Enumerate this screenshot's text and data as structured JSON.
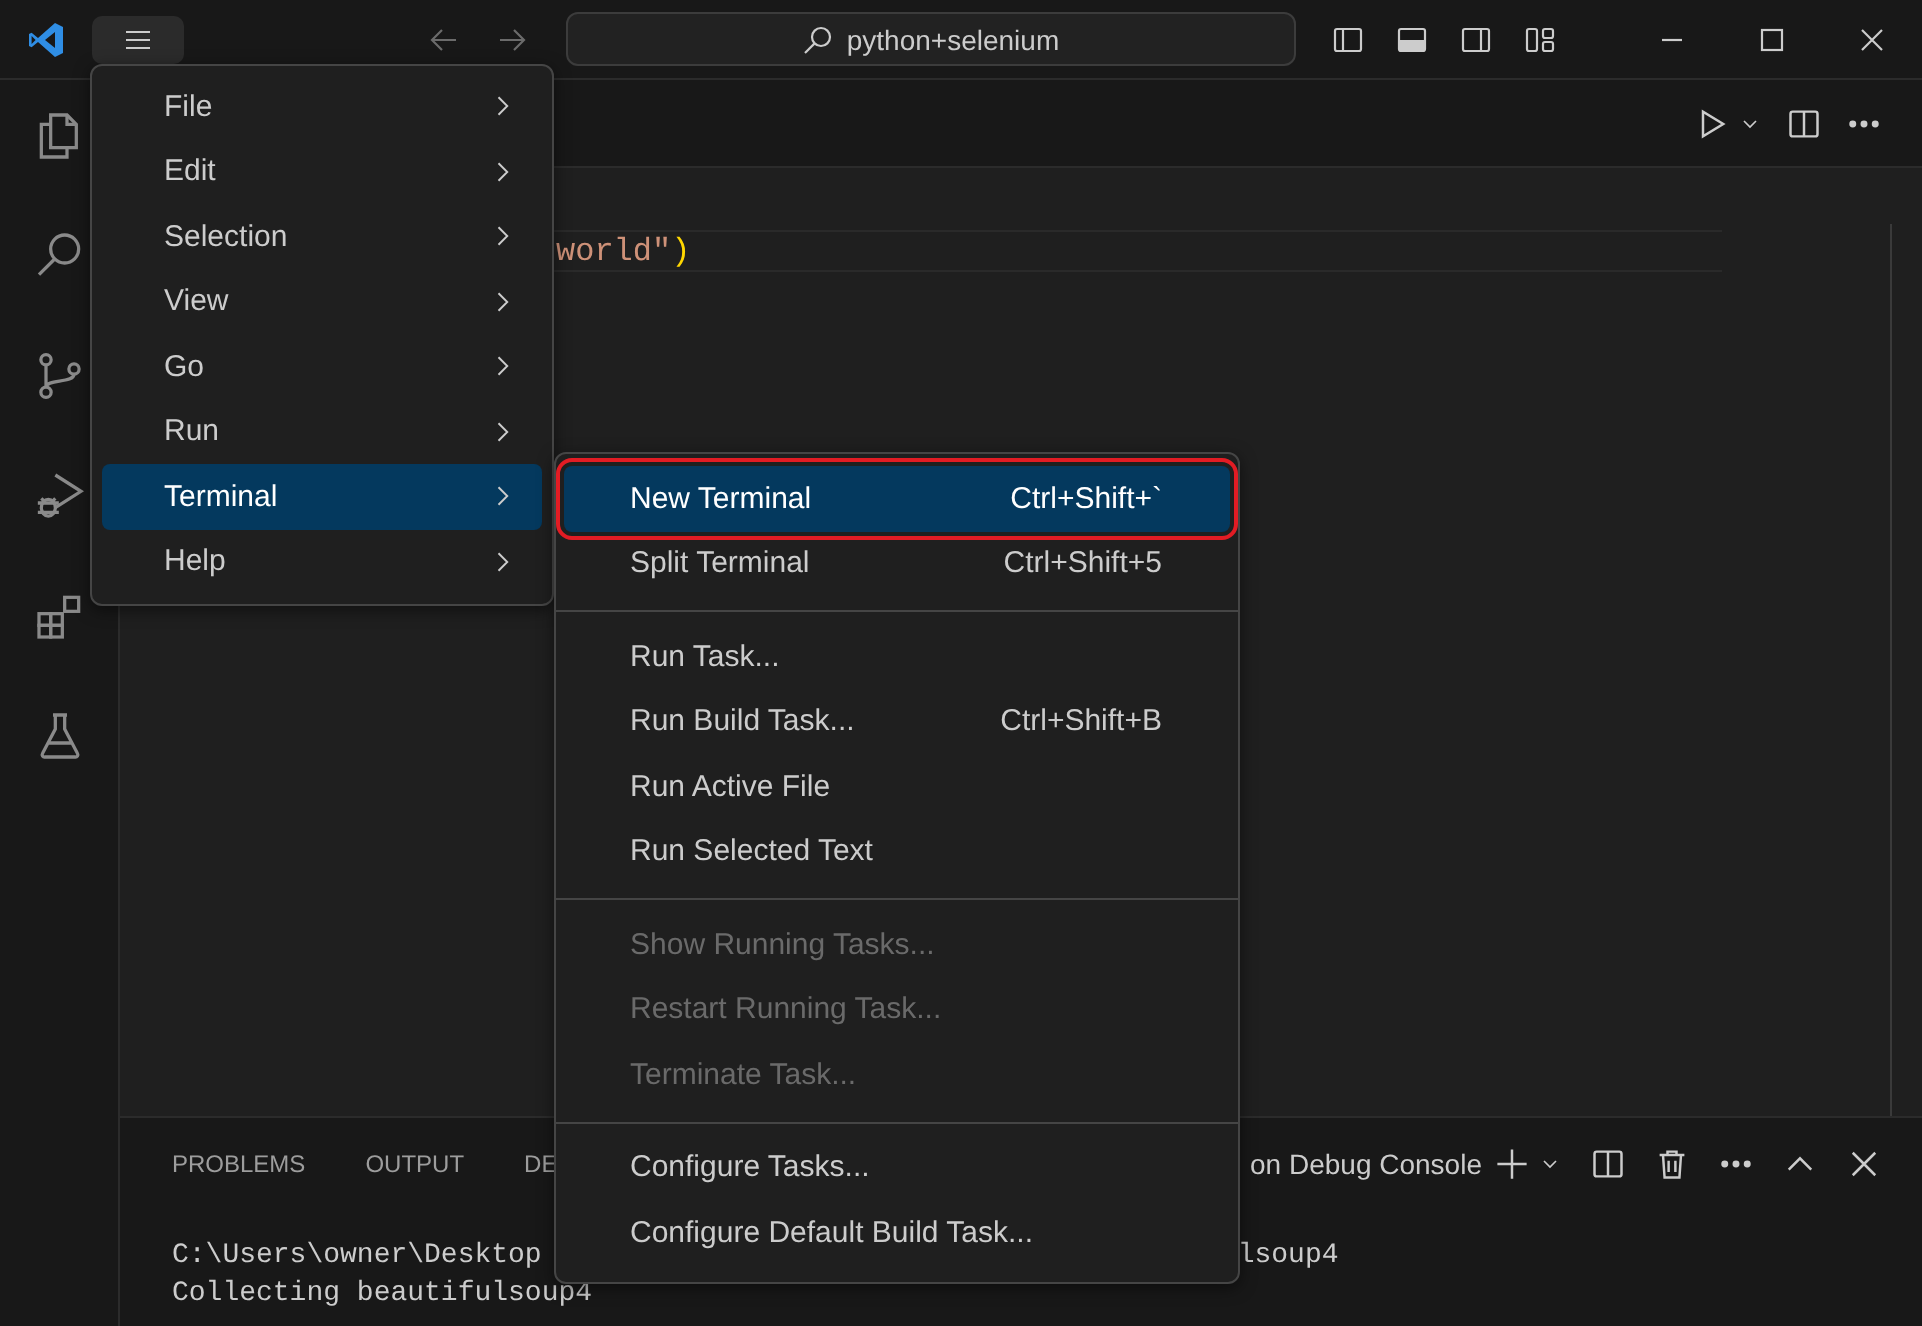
{
  "title_bar": {
    "search": "python+selenium"
  },
  "editor": {
    "code_tokens": [
      {
        "text": "world\"",
        "kind": "string"
      },
      {
        "text": ")",
        "kind": "bracket"
      }
    ]
  },
  "menu": {
    "items": [
      {
        "label": "File",
        "selected": false
      },
      {
        "label": "Edit",
        "selected": false
      },
      {
        "label": "Selection",
        "selected": false
      },
      {
        "label": "View",
        "selected": false
      },
      {
        "label": "Go",
        "selected": false
      },
      {
        "label": "Run",
        "selected": false
      },
      {
        "label": "Terminal",
        "selected": true
      },
      {
        "label": "Help",
        "selected": false
      }
    ]
  },
  "submenu": {
    "items": [
      {
        "kind": "item",
        "label": "New Terminal",
        "shortcut": "Ctrl+Shift+`",
        "selected": true,
        "disabled": false,
        "annotated": true
      },
      {
        "kind": "item",
        "label": "Split Terminal",
        "shortcut": "Ctrl+Shift+5",
        "selected": false,
        "disabled": false,
        "annotated": false
      },
      {
        "kind": "separator"
      },
      {
        "kind": "item",
        "label": "Run Task...",
        "selected": false,
        "disabled": false,
        "annotated": false
      },
      {
        "kind": "item",
        "label": "Run Build Task...",
        "shortcut": "Ctrl+Shift+B",
        "selected": false,
        "disabled": false,
        "annotated": false
      },
      {
        "kind": "item",
        "label": "Run Active File",
        "selected": false,
        "disabled": false,
        "annotated": false
      },
      {
        "kind": "item",
        "label": "Run Selected Text",
        "selected": false,
        "disabled": false,
        "annotated": false
      },
      {
        "kind": "separator"
      },
      {
        "kind": "item",
        "label": "Show Running Tasks...",
        "selected": false,
        "disabled": true,
        "annotated": false
      },
      {
        "kind": "item",
        "label": "Restart Running Task...",
        "selected": false,
        "disabled": true,
        "annotated": false
      },
      {
        "kind": "item",
        "label": "Terminate Task...",
        "selected": false,
        "disabled": true,
        "annotated": false
      },
      {
        "kind": "separator"
      },
      {
        "kind": "item",
        "label": "Configure Tasks...",
        "selected": false,
        "disabled": false,
        "annotated": false
      },
      {
        "kind": "item",
        "label": "Configure Default Build Task...",
        "selected": false,
        "disabled": false,
        "annotated": false
      }
    ]
  },
  "panel": {
    "tabs": [
      {
        "label": "PROBLEMS"
      },
      {
        "label": "OUTPUT"
      },
      {
        "label": "DE"
      }
    ],
    "terminal_name": "on Debug Console",
    "terminal_lines": [
      {
        "left": "C:\\Users\\owner\\Desktop",
        "right": "lsoup4"
      },
      {
        "left": "Collecting beautifulsoup4"
      }
    ]
  }
}
